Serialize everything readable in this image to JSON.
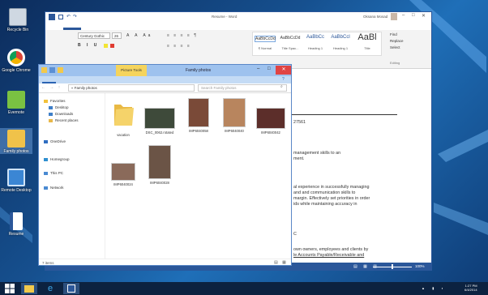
{
  "desktop": {
    "icons": [
      {
        "label": "Recycle Bin",
        "icon": "recycle-bin-icon"
      },
      {
        "label": "Google Chrome",
        "icon": "chrome-icon"
      },
      {
        "label": "Evernote",
        "icon": "evernote-icon"
      },
      {
        "label": "Family photos",
        "icon": "user-folder-icon"
      },
      {
        "label": "Remote Desktop",
        "icon": "remote-desktop-icon"
      },
      {
        "label": "Resume",
        "icon": "document-icon"
      }
    ]
  },
  "word": {
    "title": "Resume - Word",
    "user": "Oksana Mosad",
    "tabs": [
      "FILE",
      "HOME",
      "INSERT",
      "DESIGN",
      "PAGE LAYOUT",
      "REFERENCES",
      "MAILINGS",
      "REVIEW",
      "VIEW"
    ],
    "font_name": "Century Gothic",
    "font_size": "26",
    "styles": [
      "AaBbCcDd",
      "AaBbCcDd",
      "AaBbCc",
      "AaBbCcl",
      "AaBl"
    ],
    "style_names": [
      "¶ Normal",
      "Title Spac...",
      "Heading 1",
      "Heading 1",
      "Title"
    ],
    "editing": [
      "Find",
      "Replace",
      "Select"
    ],
    "group_editing": "Editing",
    "doc_lines": [
      "27561",
      "management skills to an",
      "ment.",
      "al experience in successfully managing",
      "and and communication skills to",
      "margin. Effectively set priorities in order",
      "ids while maintaining accuracy in",
      "C",
      "own owners, employees and clients by",
      "le Accounts Payable/Receivable and"
    ],
    "zoom": "100%"
  },
  "explorer": {
    "title": "Family photos",
    "context_tab": "Picture Tools",
    "tabs": [
      "File",
      "Home",
      "Share",
      "View",
      "Manage"
    ],
    "breadcrumb": "« Family photos",
    "search_placeholder": "Search Family photos",
    "nav": [
      {
        "label": "Favorites",
        "icon": "star-icon",
        "color": "#f2c13b"
      },
      {
        "label": "Desktop",
        "icon": "desktop-icon",
        "color": "#3f7fc8"
      },
      {
        "label": "Downloads",
        "icon": "download-icon",
        "color": "#3f7fc8"
      },
      {
        "label": "Recent places",
        "icon": "recent-places-icon",
        "color": "#e8b84a"
      },
      {
        "label": "OneDrive",
        "icon": "onedrive-icon",
        "color": "#2f6ec1"
      },
      {
        "label": "Homegroup",
        "icon": "homegroup-icon",
        "color": "#2f8fd0"
      },
      {
        "label": "This PC",
        "icon": "pc-icon",
        "color": "#4a8ad2"
      },
      {
        "label": "Network",
        "icon": "network-icon",
        "color": "#4a8ad2"
      }
    ],
    "items": [
      {
        "label": "vacation",
        "kind": "folder"
      },
      {
        "label": "DSC_0062.rotated",
        "kind": "photo",
        "color": "#3e4a3a"
      },
      {
        "label": "IMP6040058",
        "kind": "photo",
        "color": "#7a4a38"
      },
      {
        "label": "IMP6040040",
        "kind": "photo",
        "color": "#b8855e"
      },
      {
        "label": "IMP6040042",
        "kind": "photo",
        "color": "#5c2e2a"
      },
      {
        "label": "IMP6040024",
        "kind": "photo",
        "color": "#8a6a5a"
      },
      {
        "label": "IMP6040028",
        "kind": "photo",
        "color": "#6b5446"
      }
    ],
    "status": "7 items"
  },
  "taskbar": {
    "time": "1:27 PM",
    "date": "6/4/2014"
  },
  "colors": {
    "word_blue": "#2b579a",
    "explorer_title": "#9ec2ee",
    "close_red": "#e04343",
    "folder_yellow": "#f5d36a"
  }
}
